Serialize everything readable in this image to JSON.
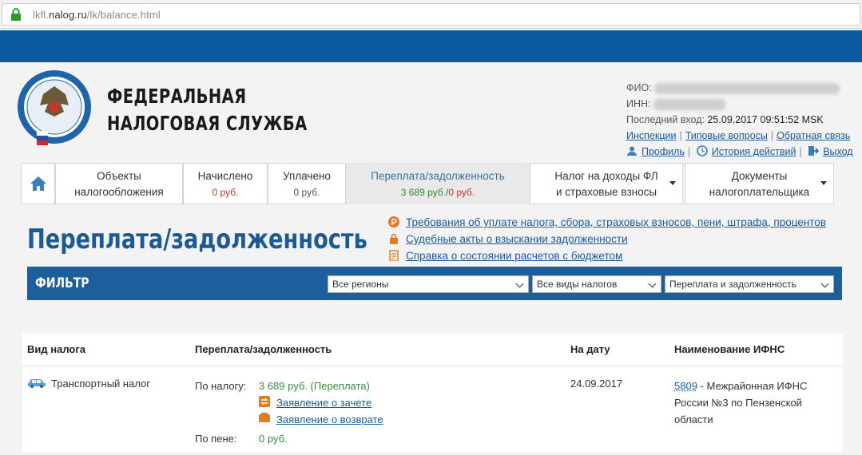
{
  "browser": {
    "url_prefix": "lkfl.",
    "url_domain": "nalog.ru",
    "url_path": "/lk/balance.html"
  },
  "header": {
    "org_line1": "ФЕДЕРАЛЬНАЯ",
    "org_line2": "НАЛОГОВАЯ СЛУЖБА"
  },
  "user": {
    "fio_label": "ФИО:",
    "inn_label": "ИНН:",
    "last_login_label": "Последний вход:",
    "last_login_value": "25.09.2017 09:51:52 MSK",
    "links": [
      "Инспекции",
      "Типовые вопросы",
      "Обратная связь"
    ],
    "profile": "Профиль",
    "history": "История действий",
    "logout": "Выход"
  },
  "tabs": [
    {
      "line1": "Объекты",
      "line2": "налогообложения"
    },
    {
      "line1": "Начислено",
      "amount": "0 руб."
    },
    {
      "line1": "Уплачено",
      "amount": "0 руб."
    },
    {
      "line1": "Переплата/задолженность",
      "amount_green": "3 689 руб.",
      "amount_sep": "/",
      "amount_red": "0 руб."
    },
    {
      "line1": "Налог на доходы ФЛ",
      "line2": "и страховые взносы"
    },
    {
      "line1": "Документы",
      "line2": "налогоплательщика"
    }
  ],
  "page": {
    "title": "Переплата/задолженность"
  },
  "doc_links": [
    "Требования об уплате налога, сбора, страховых взносов, пени, штрафа, процентов",
    "Судебные акты о взыскании задолженности",
    "Справка о состоянии расчетов с бюджетом"
  ],
  "filter": {
    "label": "ФИЛЬТР",
    "region": "Все регионы",
    "tax_type": "Все виды налогов",
    "balance_type": "Переплата и задолженность"
  },
  "table": {
    "headers": [
      "Вид налога",
      "Переплата/задолженность",
      "На дату",
      "Наименование ИФНС"
    ],
    "row": {
      "tax_name": "Транспортный налог",
      "tax_label": "По налогу:",
      "tax_value": "3 689 руб. (Переплата)",
      "offset_link": "Заявление о зачете",
      "refund_link": "Заявление о возврате",
      "penalty_label": "По пене:",
      "penalty_value": "0 руб.",
      "date": "24.09.2017",
      "ifns_code": "5809",
      "ifns_name_1": " - Межрайонная ИФНС",
      "ifns_name_2": "России №3 по Пензенской",
      "ifns_name_3": "области"
    }
  },
  "colors": {
    "brand_blue": "#0a5ba0",
    "filter_blue": "#1b5f9c",
    "title_blue": "#1b5a97",
    "link": "#1a5aa0",
    "overpayment_green": "#3c8c3c",
    "debt_red": "#c0392b"
  }
}
